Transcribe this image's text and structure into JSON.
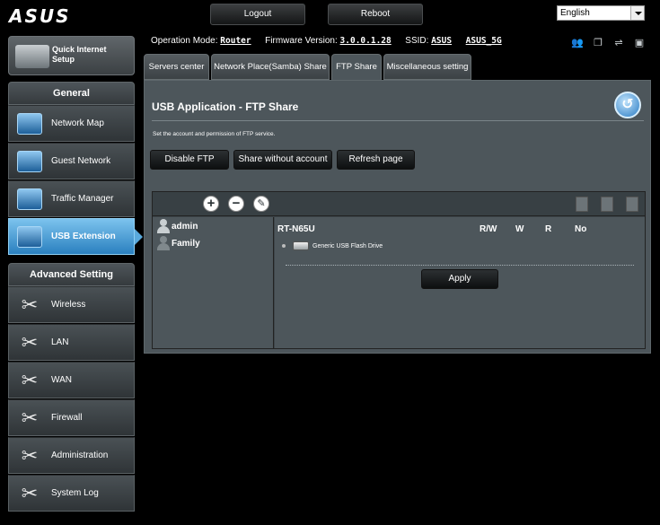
{
  "brand": {
    "logo_text": "ASUS"
  },
  "top": {
    "logout_label": "Logout",
    "reboot_label": "Reboot",
    "language": "English"
  },
  "quick_setup": {
    "line1": "Quick Internet",
    "line2": "Setup"
  },
  "general": {
    "header": "General",
    "items": [
      {
        "label": "Network Map",
        "icon": "network-map-icon"
      },
      {
        "label": "Guest Network",
        "icon": "guest-network-icon"
      },
      {
        "label": "Traffic Manager",
        "icon": "traffic-manager-icon"
      },
      {
        "label": "USB Extension",
        "icon": "usb-extension-icon",
        "active": true
      }
    ]
  },
  "advanced": {
    "header": "Advanced Setting",
    "items": [
      {
        "label": "Wireless",
        "icon": "tool-icon"
      },
      {
        "label": "LAN",
        "icon": "tool-icon"
      },
      {
        "label": "WAN",
        "icon": "tool-icon"
      },
      {
        "label": "Firewall",
        "icon": "tool-icon"
      },
      {
        "label": "Administration",
        "icon": "tool-icon"
      },
      {
        "label": "System Log",
        "icon": "tool-icon"
      }
    ]
  },
  "status": {
    "mode_label": "Operation Mode:",
    "mode_value": "Router",
    "fw_label": "Firmware Version:",
    "fw_value": "3.0.0.1.28",
    "ssid_label": "SSID:",
    "ssid_1": "ASUS",
    "ssid_2": "ASUS_5G"
  },
  "tabs": [
    {
      "label": "Servers center"
    },
    {
      "label": "Network Place(Samba) Share"
    },
    {
      "label": "FTP Share",
      "active": true
    },
    {
      "label": "Miscellaneous setting"
    }
  ],
  "panel": {
    "title": "USB Application - FTP Share",
    "description": "Set the account and permission of FTP service.",
    "disable_ftp": "Disable FTP",
    "share_without_account": "Share without account",
    "refresh_page": "Refresh page"
  },
  "ftp": {
    "users": [
      {
        "name": "admin"
      },
      {
        "name": "Family"
      }
    ],
    "device": "RT-N65U",
    "columns": {
      "rw": "R/W",
      "w": "W",
      "r": "R",
      "no": "No"
    },
    "drive": "Generic USB Flash Drive",
    "apply_label": "Apply"
  }
}
